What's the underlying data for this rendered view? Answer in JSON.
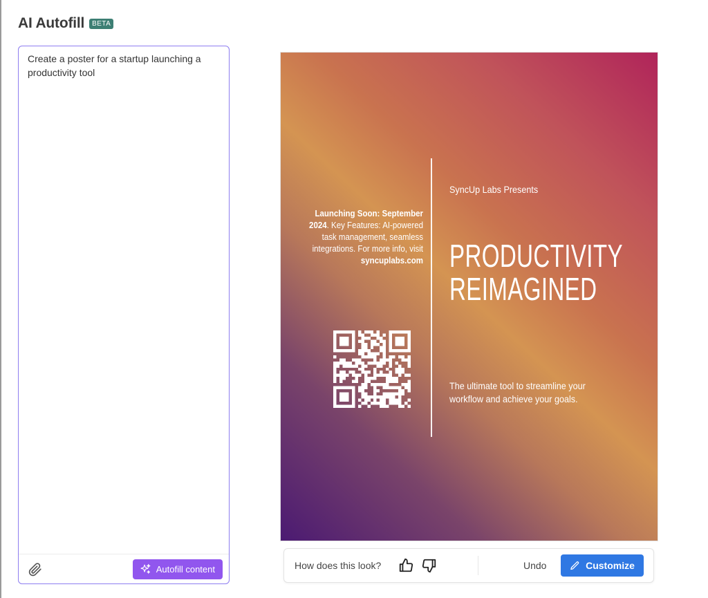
{
  "header": {
    "title": "AI Autofill",
    "badge": "BETA"
  },
  "prompt": {
    "value": "Create a poster for a startup launching a productivity tool",
    "attach_icon": "paperclip-icon",
    "autofill_icon": "sparkles-icon",
    "autofill_label": "Autofill content"
  },
  "poster": {
    "presents": "SyncUp Labs Presents",
    "headline": "PRODUCTIVITY\nREIMAGINED",
    "tagline": "The ultimate tool to streamline your workflow and achieve your goals.",
    "details": {
      "launch_label": "Launching Soon:",
      "launch_date": "September 2024",
      "features_text": ". Key Features: AI-powered task management, seamless integrations. For more info, visit",
      "website": "syncuplabs.com"
    },
    "qr_icon": "qr-code-icon"
  },
  "feedback": {
    "question": "How does this look?",
    "thumb_up_icon": "thumbs-up-icon",
    "thumb_down_icon": "thumbs-down-icon",
    "undo_label": "Undo",
    "customize_icon": "pencil-icon",
    "customize_label": "Customize"
  },
  "colors": {
    "accent_purple": "#9156ee",
    "customize_blue": "#2f78e3",
    "beta_badge": "#3d7f74",
    "prompt_border": "#8d7cf0"
  }
}
